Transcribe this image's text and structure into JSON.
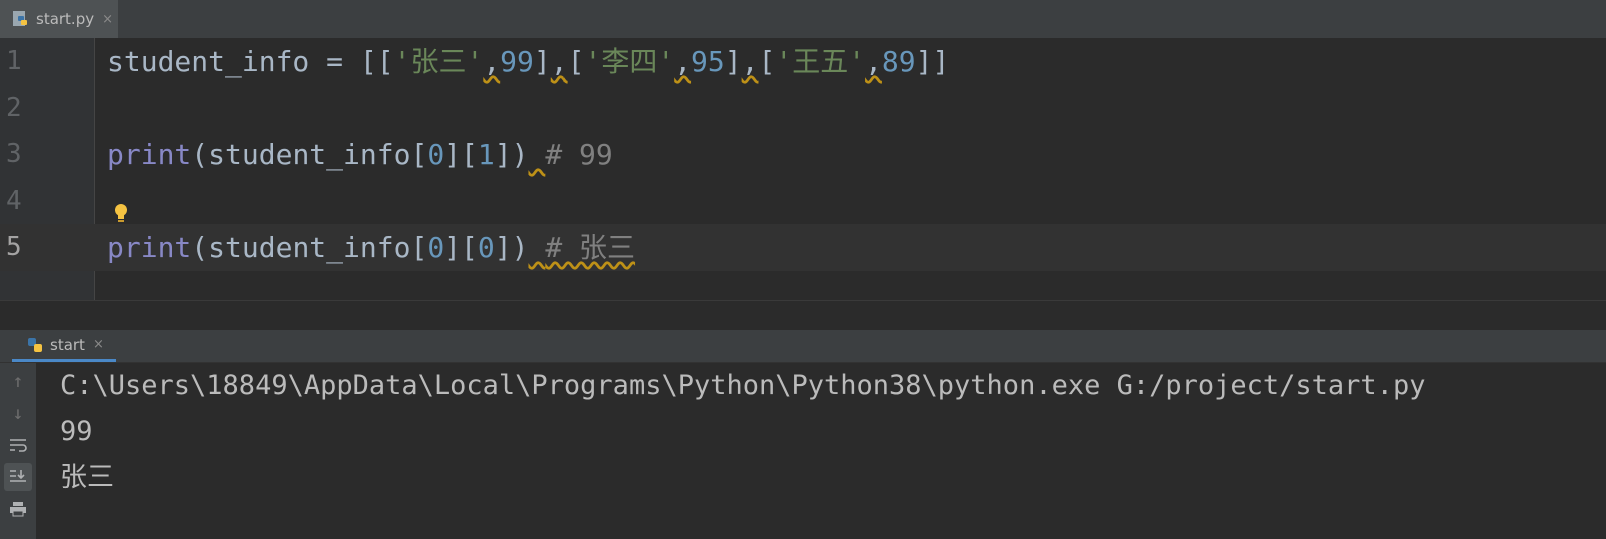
{
  "editor_tab": {
    "filename": "start.py",
    "close": "×"
  },
  "code_lines": [
    {
      "number": "1"
    },
    {
      "number": "2"
    },
    {
      "number": "3"
    },
    {
      "number": "4"
    },
    {
      "number": "5"
    }
  ],
  "code": {
    "l1_var": "student_info",
    "l1_eq": " = ",
    "l1_open": "[[",
    "l1_s1": "'张三'",
    "l1_c1": ",",
    "l1_n1": "99",
    "l1_b1": "]",
    "l1_c2": ",",
    "l1_o2": "[",
    "l1_s2": "'李四'",
    "l1_c3": ",",
    "l1_n2": "95",
    "l1_b2": "]",
    "l1_c4": ",",
    "l1_o3": "[",
    "l1_s3": "'王五'",
    "l1_c5": ",",
    "l1_n3": "89",
    "l1_close": "]]",
    "l3_print": "print",
    "l3_a": "(student_info[",
    "l3_i1": "0",
    "l3_b": "][",
    "l3_i2": "1",
    "l3_c": "])",
    "l3_cmt": "# 99",
    "l5_print": "print",
    "l5_a": "(student_info[",
    "l5_i1": "0",
    "l5_b": "][",
    "l5_i2": "0",
    "l5_c": "])",
    "l5_cmt": "# 张三"
  },
  "run_tab": {
    "name": "start",
    "close": "×"
  },
  "console_lines": [
    "C:\\Users\\18849\\AppData\\Local\\Programs\\Python\\Python38\\python.exe G:/project/start.py",
    "99",
    "张三"
  ],
  "colors": {
    "background": "#2b2b2b",
    "keyword": "#8888c6",
    "string": "#6a8759",
    "number": "#6897bb",
    "comment": "#808080",
    "text": "#a9b7c6",
    "warning_underline": "#be9117"
  },
  "icons": [
    "python-file-icon",
    "lightbulb-icon",
    "arrow-up-icon",
    "arrow-down-icon",
    "soft-wrap-icon",
    "scroll-to-end-icon",
    "print-icon"
  ]
}
